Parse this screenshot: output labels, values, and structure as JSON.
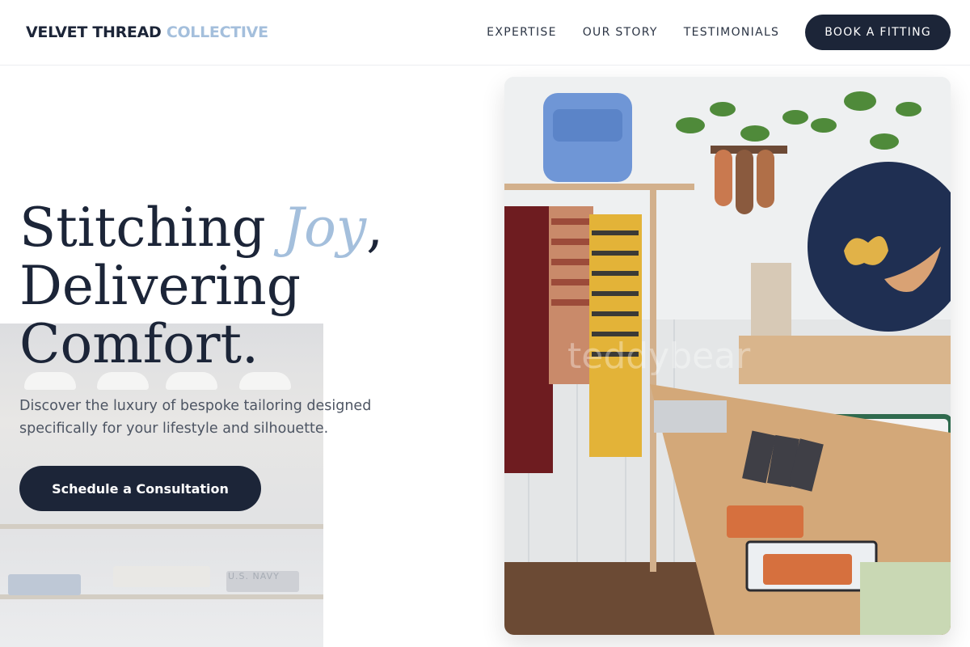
{
  "header": {
    "logo_main": "VELVET THREAD",
    "logo_accent": "COLLECTIVE",
    "nav": [
      {
        "label": "EXPERTISE"
      },
      {
        "label": "OUR STORY"
      },
      {
        "label": "TESTIMONIALS"
      }
    ],
    "cta_label": "BOOK A FITTING"
  },
  "hero": {
    "title_start": "Stitching ",
    "title_accent": "Joy",
    "title_comma": ",",
    "title_line2": "Delivering",
    "title_line3": "Comfort.",
    "subtitle": "Discover the luxury of bespoke tailoring designed specifically for your lifestyle and silhouette.",
    "cta_label": "Schedule a Consultation"
  },
  "background_photo": {
    "shelf_text": "U.S. NAVY"
  },
  "product_photo": {
    "watermark": "teddybear"
  },
  "colors": {
    "primary": "#1c2538",
    "accent": "#a4bfdc",
    "text_muted": "#4d5563"
  }
}
